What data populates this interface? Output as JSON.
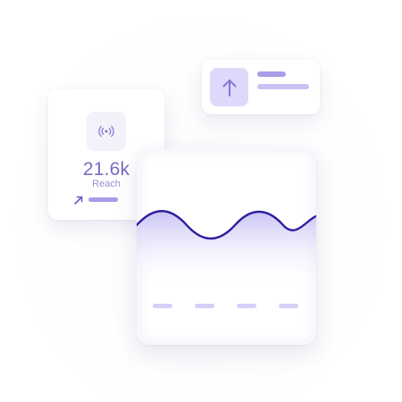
{
  "upload_card": {
    "icon": "arrow-up-icon"
  },
  "reach_card": {
    "icon": "broadcast-signal-icon",
    "value": "21.6k",
    "label": "Reach",
    "trend_icon": "arrow-up-right-icon"
  },
  "chart_card": {
    "wave_color": "#2e1f9e",
    "fill_top_color": "#c9c3f4",
    "fill_bottom_color": "#ffffff"
  },
  "colors": {
    "accent": "#7b6bc6",
    "tile": "#dcd9fb",
    "bar": "#a99be8"
  }
}
